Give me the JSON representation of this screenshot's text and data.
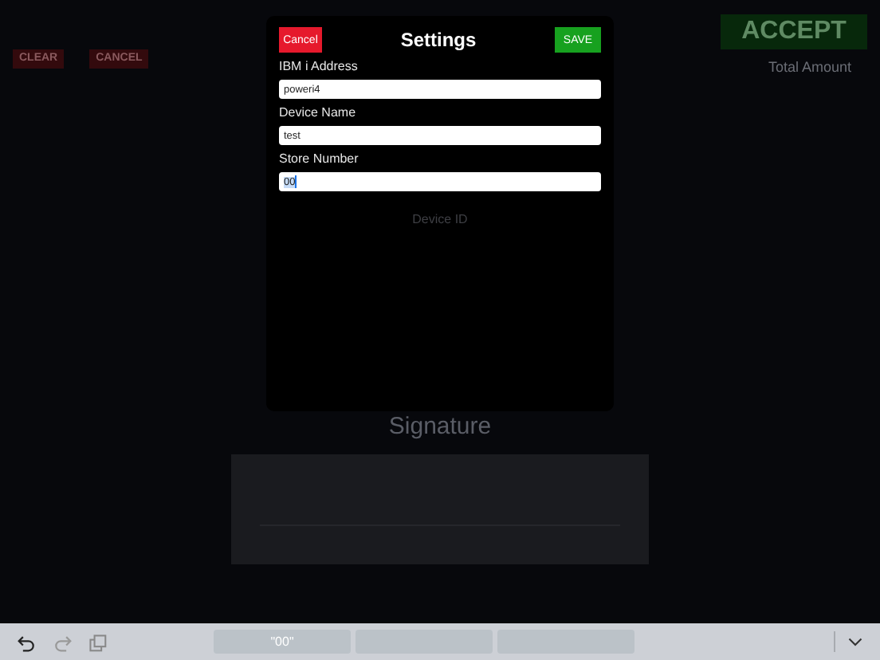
{
  "background": {
    "buttons": [
      "CLEAR",
      "CANCEL"
    ],
    "accept": "ACCEPT",
    "total_label": "Total Amount",
    "signature_label": "Signature"
  },
  "dialog": {
    "title": "Settings",
    "cancel": "Cancel",
    "save": "SAVE",
    "fields": [
      {
        "label": "IBM i Address",
        "value": "poweri4",
        "focused": false
      },
      {
        "label": "Device Name",
        "value": "test",
        "focused": false
      },
      {
        "label": "Store Number",
        "value": "00",
        "focused": true
      }
    ],
    "footer": "Device ID"
  },
  "keyboard_bar": {
    "suggestions": [
      "\"00\""
    ]
  }
}
